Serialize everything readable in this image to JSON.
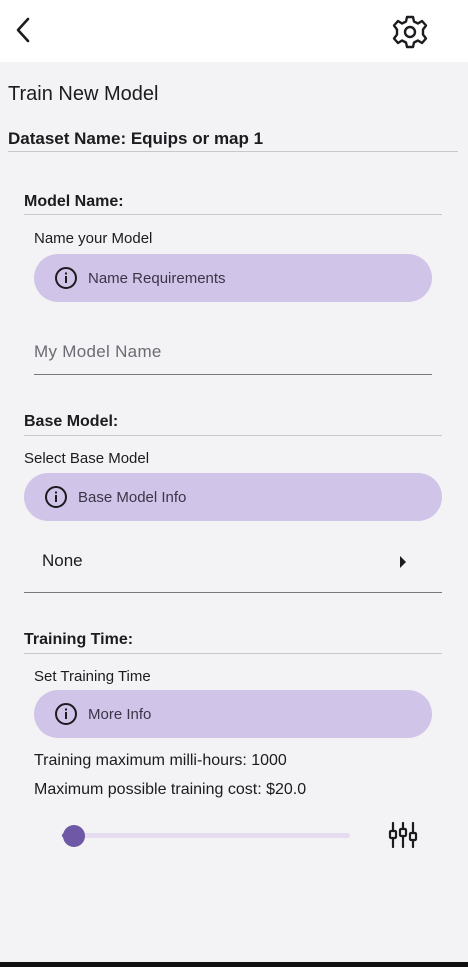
{
  "appbar": {
    "back_icon": "arrow-back-icon",
    "settings_icon": "gear-icon"
  },
  "page_title": "Train New Model",
  "dataset_label": "Dataset Name: Equips or map 1",
  "model_name": {
    "section_title": "Model Name:",
    "subtitle": "Name your Model",
    "info_label": "Name Requirements",
    "input_placeholder": "My Model Name",
    "input_value": ""
  },
  "base_model": {
    "section_title": "Base Model:",
    "subtitle": "Select Base Model",
    "info_label": "Base Model Info",
    "selected": "None"
  },
  "training_time": {
    "section_title": "Training Time:",
    "subtitle": "Set Training Time",
    "info_label": "More Info",
    "max_hours_text": "Training maximum milli-hours: 1000",
    "max_cost_text": "Maximum possible training cost: $20.0",
    "slider_fraction": 0.04,
    "tune_icon": "tune-icon"
  },
  "colors": {
    "accent": "#6750a4",
    "pill": "#d1c4e9",
    "background": "#f3f2f4"
  }
}
